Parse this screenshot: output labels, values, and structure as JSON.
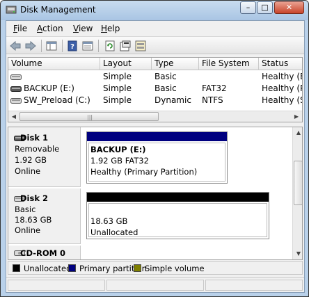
{
  "window": {
    "title": "Disk Management",
    "minimize_glyph": "–",
    "maximize_glyph": "□",
    "close_glyph": "✕"
  },
  "menu": {
    "file": {
      "accel": "F",
      "rest": "ile"
    },
    "action": {
      "accel": "A",
      "rest": "ction"
    },
    "view": {
      "accel": "V",
      "rest": "iew"
    },
    "help": {
      "accel": "H",
      "rest": "elp"
    }
  },
  "toolbar": {
    "buttons": [
      "back-arrow-icon",
      "forward-arrow-icon",
      "show-hide-tree-icon",
      "help-icon",
      "export-list-icon",
      "refresh-icon",
      "properties-icon",
      "rescan-disks-icon"
    ]
  },
  "volumes": {
    "headers": {
      "volume": "Volume",
      "layout": "Layout",
      "type": "Type",
      "filesystem": "File System",
      "status": "Status"
    },
    "rows": [
      {
        "volume": "",
        "layout": "Simple",
        "type": "Basic",
        "filesystem": "",
        "status": "Healthy (E..."
      },
      {
        "volume": "BACKUP (E:)",
        "layout": "Simple",
        "type": "Basic",
        "filesystem": "FAT32",
        "status": "Healthy (P..."
      },
      {
        "volume": "SW_Preload (C:)",
        "layout": "Simple",
        "type": "Dynamic",
        "filesystem": "NTFS",
        "status": "Healthy (S..."
      }
    ]
  },
  "disks": [
    {
      "name": "Disk 1",
      "kind": "Removable",
      "size": "1.92 GB",
      "state": "Online",
      "partition": {
        "label": "BACKUP  (E:)",
        "detail": "1.92 GB FAT32",
        "status": "Healthy (Primary Partition)",
        "color": "#00007f"
      }
    },
    {
      "name": "Disk 2",
      "kind": "Basic",
      "size": "18.63 GB",
      "state": "Online",
      "partition": {
        "label": "",
        "detail": "18.63 GB",
        "status": "Unallocated",
        "color": "#000000"
      }
    },
    {
      "name": "CD-ROM 0"
    }
  ],
  "legend": [
    {
      "label": "Unallocated",
      "color": "#000000"
    },
    {
      "label": "Primary partition",
      "color": "#00007f"
    },
    {
      "label": "Simple volume",
      "color": "#808000"
    }
  ]
}
